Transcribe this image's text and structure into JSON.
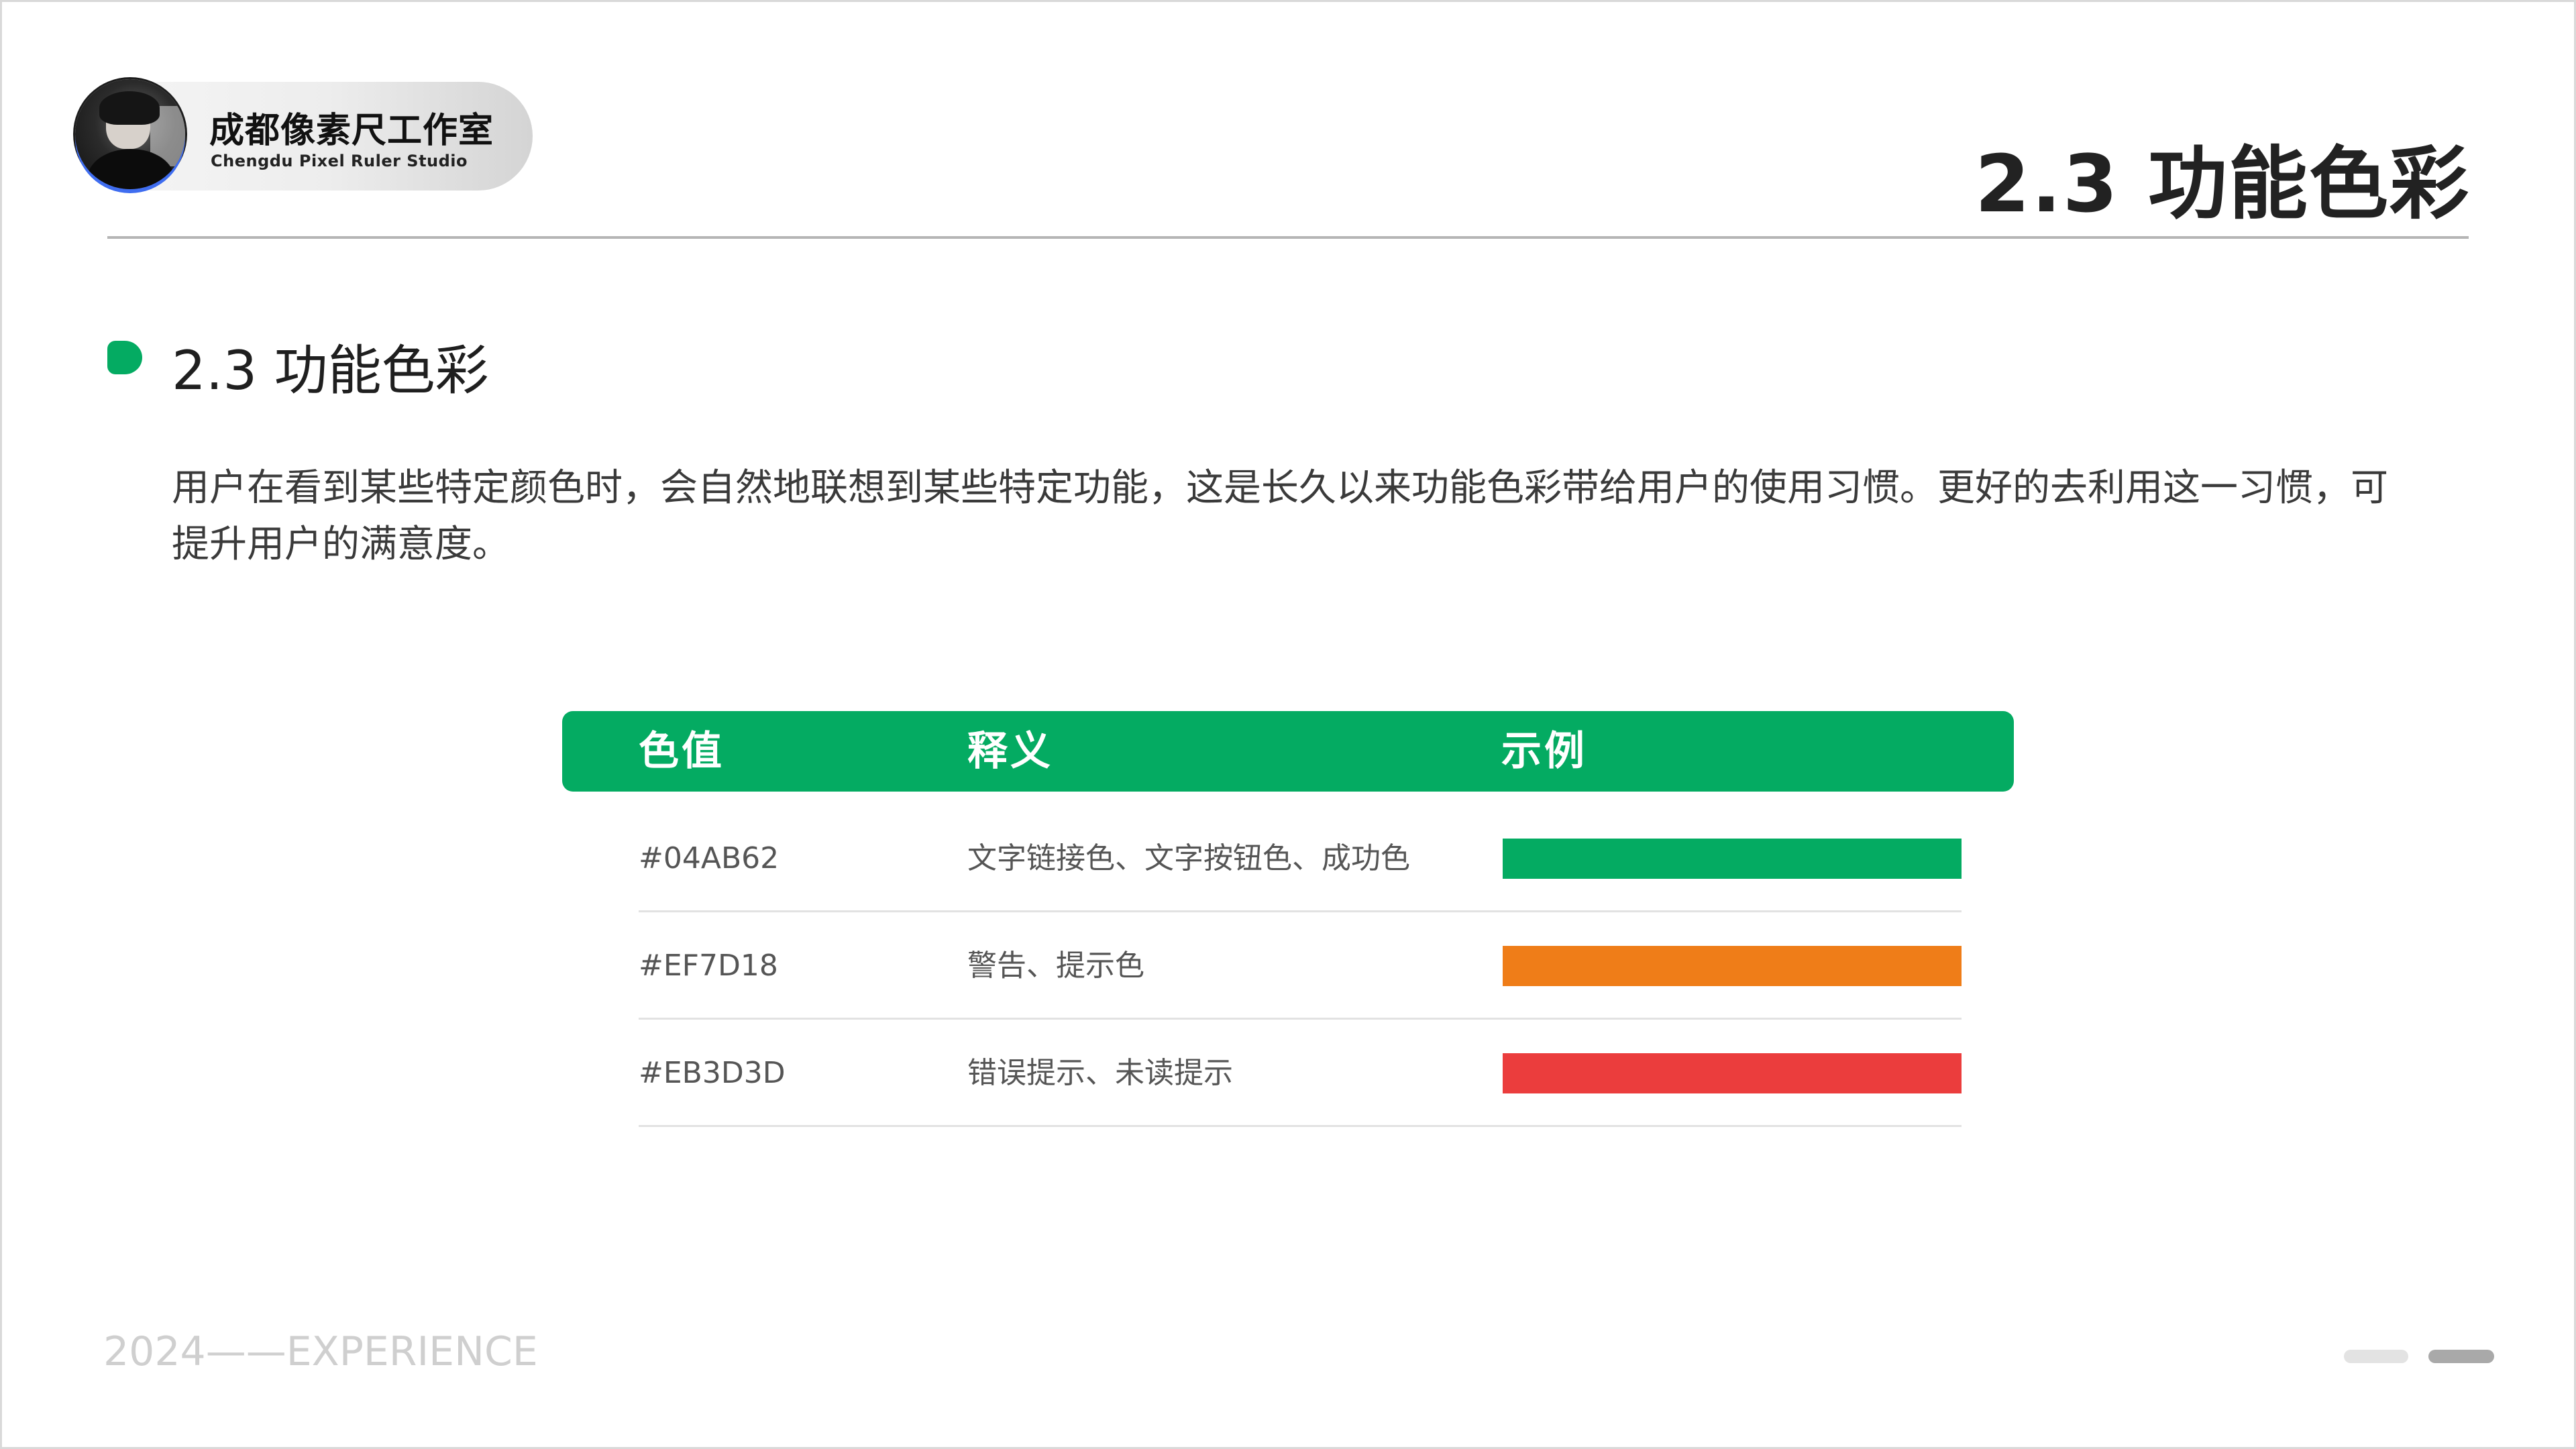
{
  "brand": {
    "title": "成都像素尺工作室",
    "subtitle": "Chengdu Pixel Ruler Studio"
  },
  "header": {
    "title": "2.3 功能色彩"
  },
  "section": {
    "title": "2.3 功能色彩",
    "intro": "用户在看到某些特定颜色时，会自然地联想到某些特定功能，这是长久以来功能色彩带给用户的使用习惯。更好的去利用这一习惯，可提升用户的满意度。"
  },
  "table": {
    "headers": [
      "色值",
      "释义",
      "示例"
    ],
    "header_color": "#04AB62",
    "rows": [
      {
        "hex": "#04AB62",
        "desc": "文字链接色、文字按钮色、成功色",
        "color": "#04AB62"
      },
      {
        "hex": "#EF7D18",
        "desc": "警告、提示色",
        "color": "#EF7D18"
      },
      {
        "hex": "#EB3D3D",
        "desc": "错误提示、未读提示",
        "color": "#EB3D3D"
      }
    ]
  },
  "footer": {
    "text": "2024——EXPERIENCE"
  },
  "pager": {
    "total": 2,
    "current": 2
  }
}
